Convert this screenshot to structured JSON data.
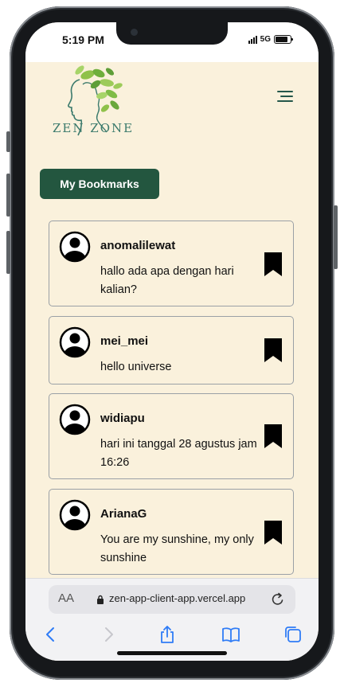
{
  "status_bar": {
    "time": "5:19 PM",
    "network": "5G"
  },
  "header": {
    "logo_text": "ZEN ZONE",
    "menu_icon": "hamburger-menu-icon"
  },
  "bookmarks_button": {
    "label": "My Bookmarks"
  },
  "posts": [
    {
      "username": "anomalilewat",
      "message": "hallo ada apa dengan hari kalian?"
    },
    {
      "username": "mei_mei",
      "message": "hello universe"
    },
    {
      "username": "widiapu",
      "message": "hari ini tanggal 28 agustus jam 16:26"
    },
    {
      "username": "ArianaG",
      "message": "You are my sunshine, my only sunshine"
    }
  ],
  "safari": {
    "text_size_label": "AA",
    "url": "zen-app-client-app.vercel.app"
  },
  "colors": {
    "background": "#faf1dc",
    "primary": "#23563f",
    "accent": "#3b7a6c"
  }
}
